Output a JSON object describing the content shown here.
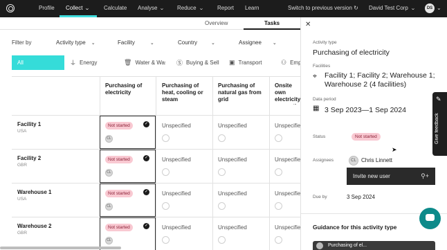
{
  "topnav": {
    "items": [
      {
        "label": "Profile"
      },
      {
        "label": "Collect"
      },
      {
        "label": "Calculate"
      },
      {
        "label": "Analyse"
      },
      {
        "label": "Reduce"
      },
      {
        "label": "Report"
      },
      {
        "label": "Learn"
      }
    ],
    "switch_version": "Switch to previous version",
    "company": "David Test Corp",
    "user_initials": "DS",
    "accent": "#3fdcdc"
  },
  "subtabs": [
    {
      "label": "Overview"
    },
    {
      "label": "Tasks"
    }
  ],
  "filters": {
    "label": "Filter by",
    "items": [
      {
        "label": "Activity type"
      },
      {
        "label": "Facility"
      },
      {
        "label": "Country"
      },
      {
        "label": "Assignee"
      }
    ]
  },
  "categories": [
    {
      "label": "All",
      "icon": "none"
    },
    {
      "label": "Energy",
      "icon": "energy-icon"
    },
    {
      "label": "Water & Waste",
      "icon": "bin-icon"
    },
    {
      "label": "Buying & Selling",
      "icon": "dollar-icon"
    },
    {
      "label": "Transport",
      "icon": "bus-icon"
    },
    {
      "label": "Emp",
      "icon": "people-icon"
    }
  ],
  "table": {
    "columns": [
      "Purchasing of electricity",
      "Purchasing of heat, cooling or steam",
      "Purchasing of natural gas from grid",
      "Onsite own electricity generation"
    ],
    "rows": [
      {
        "name": "Facility 1",
        "country": "USA",
        "first": "Not started",
        "initials": "CL",
        "others": "Unspecified"
      },
      {
        "name": "Facility 2",
        "country": "GBR",
        "first": "Not started",
        "initials": "CL",
        "others": "Unspecified"
      },
      {
        "name": "Warehouse 1",
        "country": "USA",
        "first": "Not started",
        "initials": "CL",
        "others": "Unspecified"
      },
      {
        "name": "Warehouse 2",
        "country": "GBR",
        "first": "Not started",
        "initials": "CL",
        "others": "Unspecified"
      }
    ]
  },
  "panel": {
    "activity_type_label": "Activity type",
    "activity_type": "Purchasing of electricity",
    "facilities_label": "Facilities",
    "facilities": "Facility 1; Facility 2; Warehouse 1; Warehouse 2 (4 facilities)",
    "period_label": "Data period",
    "period": "3 Sep 2023—1 Sep 2024",
    "status_label": "Status",
    "status": "Not started",
    "assignees_label": "Assignees",
    "assignee_initials": "CL",
    "assignee": "Chris Linnett",
    "invite": "Invite new user",
    "due_label": "Due by",
    "due": "3 Sep 2024",
    "guidance": "Guidance for this activity type",
    "video_title": "Purchasing of el..."
  },
  "feedback": "Give feedback",
  "colors": {
    "status_bg": "#f9c9d2",
    "active_category": "#35dcd9",
    "chat": "#0d8a8a"
  }
}
